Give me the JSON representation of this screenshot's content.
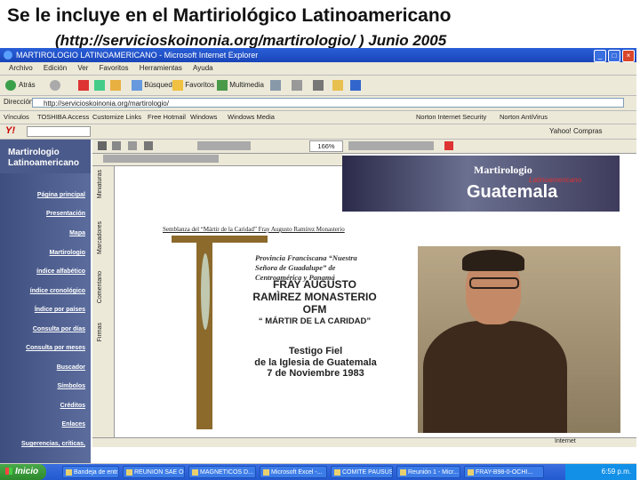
{
  "slide": {
    "title": "Se le incluye en el Martiriológico Latinoamericano",
    "subtitle": "(http://servicioskoinonia.org/martirologio/ ) Junio 2005"
  },
  "window": {
    "title": "MARTIROLOGIO LATINOAMERICANO - Microsoft Internet Explorer",
    "menu": [
      "Archivo",
      "Edición",
      "Ver",
      "Favoritos",
      "Herramientas",
      "Ayuda"
    ]
  },
  "toolbar": {
    "back": "Atrás",
    "search": "Búsqueda",
    "favorites": "Favoritos",
    "multimedia": "Multimedia"
  },
  "address": {
    "label": "Dirección",
    "value": "http://servicioskoinonia.org/martirologio/"
  },
  "links": {
    "label": "Vínculos",
    "items": [
      "TOSHIBA Access",
      "Customize Links",
      "Free Hotmail",
      "Windows",
      "Windows Media"
    ],
    "right": [
      "Norton Internet Security",
      "Norton AntiVirus"
    ]
  },
  "yahoo": {
    "logo": "Y!",
    "right": "Yahoo! Compras"
  },
  "editor": {
    "zoom": "166%",
    "side_tabs": [
      "Miniaturas",
      "Marcadores",
      "Comentario",
      "Firmas"
    ],
    "status": "Internet"
  },
  "site": {
    "brand_line1": "Martirologio",
    "brand_line2": "Latinoamericano",
    "nav": [
      "Página principal",
      "Presentación",
      "Mapa",
      "Martirologio",
      "índice alfabético",
      "índice cronológico",
      "Índice por países",
      "Consulta por días",
      "Consulta por meses",
      "Buscador",
      "Símbolos",
      "Créditos",
      "Enlaces",
      "Sugerencias, críticas,"
    ]
  },
  "banner": {
    "line1": "Martirologio",
    "line2": "Latinoamericano",
    "line3": "Guatemala"
  },
  "document": {
    "semblanza": "Semblanza del “Mártir de la Caridad” Fray Augusto Ramírez Monasterio",
    "provincia": "Provincia Franciscana “Nuestra Señora de Guadalupe” de Centroamérica y Panamá",
    "name_line1": "FRAY AUGUSTO",
    "name_line2": "RAMÌREZ MONASTERIO",
    "name_line3": "OFM",
    "name_line4": "“ MÁRTIR DE LA CARIDAD”",
    "testigo1": "Testigo Fiel",
    "testigo2": "de la Iglesia de Guatemala",
    "testigo3": "7 de Noviembre 1983"
  },
  "taskbar": {
    "start": "Inicio",
    "tasks": [
      "Bandeja de entr...",
      "REUNION SAE O...",
      "MAGNETICOS D...",
      "Microsoft Excel -...",
      "COMITE PAUSUS...",
      "Reunión 1 - Micr...",
      "FRAY-B98-0-OCHI..."
    ],
    "time": "6:59 p.m."
  },
  "colors": {
    "xp_blue": "#245ad0",
    "nav_bg": "#4a5a8a",
    "cross_gold": "#8c6a2c"
  }
}
